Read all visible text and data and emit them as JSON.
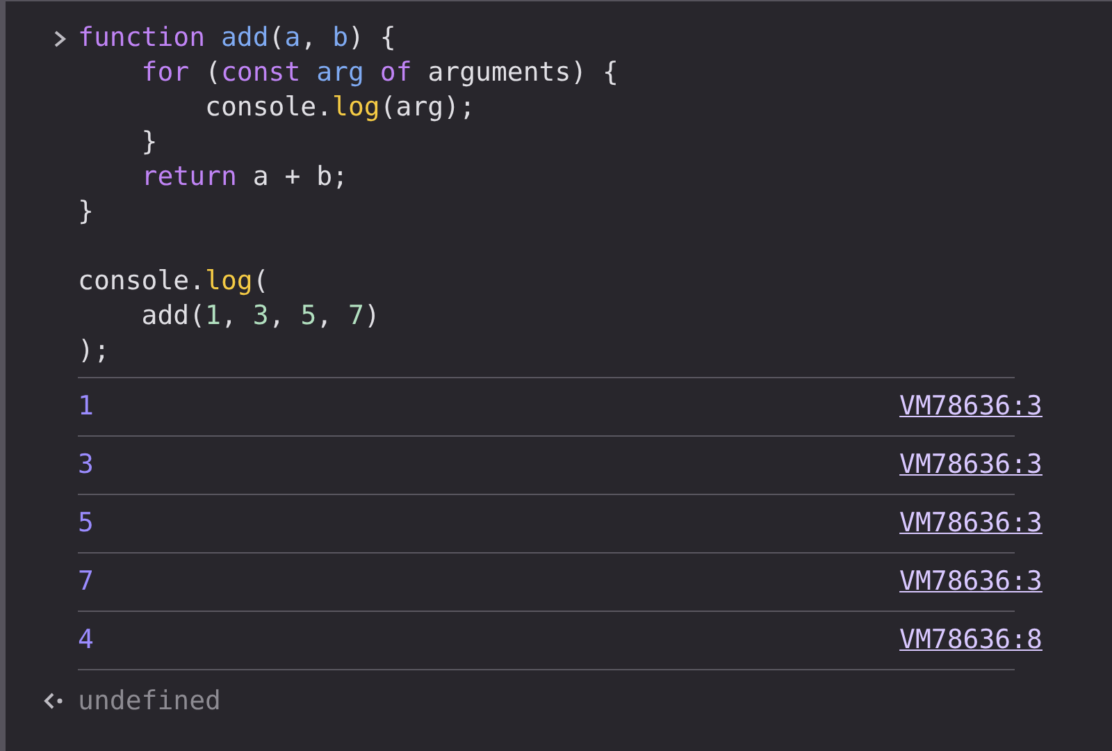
{
  "input": {
    "blocks": [
      [
        [
          {
            "text": "function ",
            "kind": "keyword"
          },
          {
            "text": "add",
            "kind": "name"
          },
          {
            "text": "(",
            "kind": "plain"
          },
          {
            "text": "a",
            "kind": "name"
          },
          {
            "text": ", ",
            "kind": "plain"
          },
          {
            "text": "b",
            "kind": "name"
          },
          {
            "text": ") {",
            "kind": "plain"
          }
        ],
        [
          {
            "text": "    for",
            "kind": "keyword"
          },
          {
            "text": " (",
            "kind": "plain"
          },
          {
            "text": "const ",
            "kind": "keyword"
          },
          {
            "text": "arg ",
            "kind": "name"
          },
          {
            "text": "of",
            "kind": "keyword"
          },
          {
            "text": " arguments) {",
            "kind": "plain"
          }
        ],
        [
          {
            "text": "        console.",
            "kind": "plain"
          },
          {
            "text": "log",
            "kind": "method"
          },
          {
            "text": "(arg);",
            "kind": "plain"
          }
        ],
        [
          {
            "text": "    }",
            "kind": "plain"
          }
        ],
        [
          {
            "text": "    return",
            "kind": "keyword"
          },
          {
            "text": " a + b;",
            "kind": "plain"
          }
        ],
        [
          {
            "text": "}",
            "kind": "plain"
          }
        ]
      ],
      [
        [
          {
            "text": "console.",
            "kind": "plain"
          },
          {
            "text": "log",
            "kind": "method"
          },
          {
            "text": "(",
            "kind": "plain"
          }
        ],
        [
          {
            "text": "    add(",
            "kind": "plain"
          },
          {
            "text": "1",
            "kind": "number"
          },
          {
            "text": ", ",
            "kind": "plain"
          },
          {
            "text": "3",
            "kind": "number"
          },
          {
            "text": ", ",
            "kind": "plain"
          },
          {
            "text": "5",
            "kind": "number"
          },
          {
            "text": ", ",
            "kind": "plain"
          },
          {
            "text": "7",
            "kind": "number"
          },
          {
            "text": ")",
            "kind": "plain"
          }
        ],
        [
          {
            "text": ");",
            "kind": "plain"
          }
        ]
      ]
    ]
  },
  "logs": [
    {
      "value": "1",
      "source": "VM78636:3"
    },
    {
      "value": "3",
      "source": "VM78636:3"
    },
    {
      "value": "5",
      "source": "VM78636:3"
    },
    {
      "value": "7",
      "source": "VM78636:3"
    },
    {
      "value": "4",
      "source": "VM78636:8"
    }
  ],
  "result": {
    "text": "undefined"
  }
}
